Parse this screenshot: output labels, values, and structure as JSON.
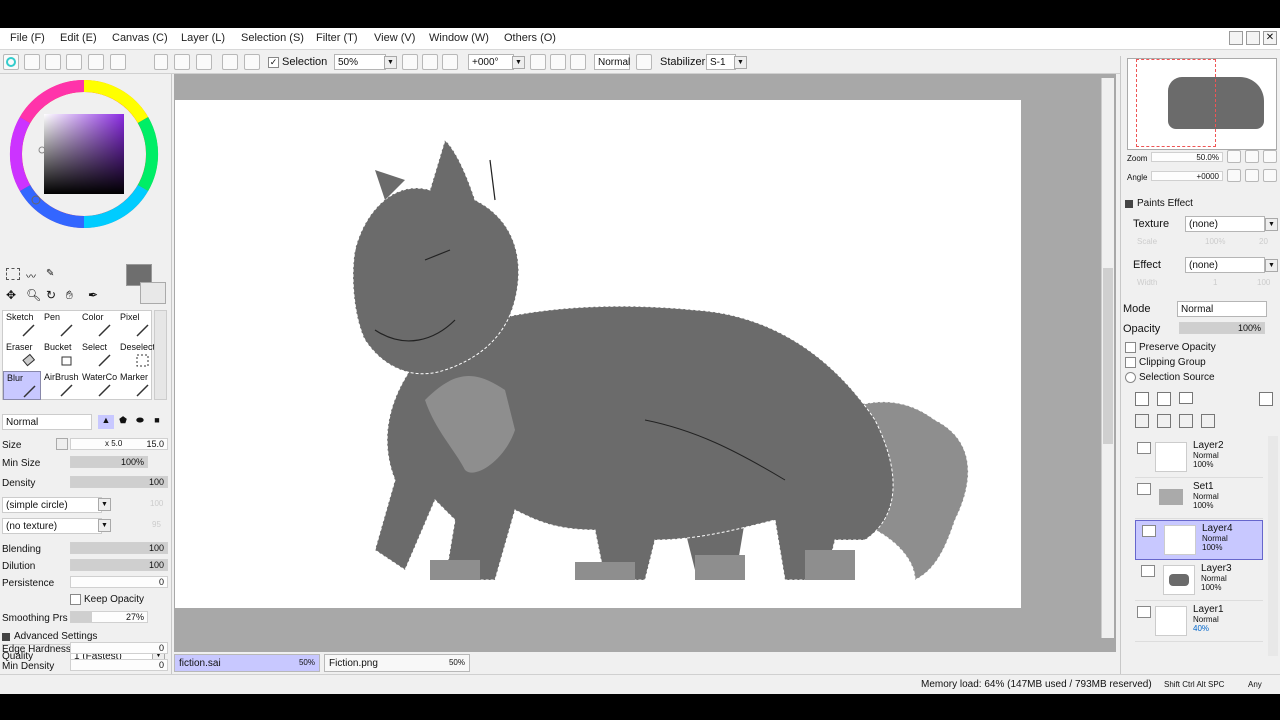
{
  "menubar": {
    "items": [
      "File (F)",
      "Edit (E)",
      "Canvas (C)",
      "Layer (L)",
      "Selection (S)",
      "Filter (T)",
      "View (V)",
      "Window (W)",
      "Others (O)"
    ]
  },
  "toolbar": {
    "selection_label": "Selection",
    "zoom_value": "50%",
    "angle_value": "+000°",
    "blend_mode": "Normal",
    "stabilizer_label": "Stabilizer",
    "stabilizer_value": "S-1"
  },
  "tools": {
    "grid": [
      {
        "name": "Sketch"
      },
      {
        "name": "Pen"
      },
      {
        "name": "Color"
      },
      {
        "name": "Pixel"
      },
      {
        "name": "Eraser"
      },
      {
        "name": "Bucket"
      },
      {
        "name": "Select"
      },
      {
        "name": "Deselect"
      },
      {
        "name": "Blur"
      },
      {
        "name": "AirBrush"
      },
      {
        "name": "WaterCo"
      },
      {
        "name": "Marker"
      }
    ]
  },
  "brush": {
    "mode": "Normal",
    "size_label": "Size",
    "size_mult": "x 5.0",
    "size_value": "15.0",
    "minsize_label": "Min Size",
    "minsize_value": "100%",
    "density_label": "Density",
    "density_value": "100",
    "shape": "(simple circle)",
    "shape_val": "100",
    "texture": "(no texture)",
    "texture_val": "95",
    "blending_label": "Blending",
    "blending_value": "100",
    "dilution_label": "Dilution",
    "dilution_value": "100",
    "persistence_label": "Persistence",
    "persistence_value": "0",
    "keep_opacity_label": "Keep Opacity",
    "smoothing_label": "Smoothing Prs",
    "smoothing_value": "27%",
    "advanced_label": "Advanced Settings",
    "quality_label": "Quality",
    "quality_value": "1 (Fastest)",
    "edge_label": "Edge Hardness",
    "edge_value": "0",
    "mindensity_label": "Min Density",
    "mindensity_value": "0"
  },
  "navigator": {
    "zoom_label": "Zoom",
    "zoom_value": "50.0%",
    "angle_label": "Angle",
    "angle_value": "+0000"
  },
  "paints_effect": {
    "header": "Paints Effect",
    "texture_label": "Texture",
    "texture_value": "(none)",
    "scale_label": "Scale",
    "scale_value": "100%",
    "scale_num": "20",
    "effect_label": "Effect",
    "effect_value": "(none)",
    "width_label": "Width",
    "width_value": "1",
    "width_num": "100"
  },
  "layer_props": {
    "mode_label": "Mode",
    "mode_value": "Normal",
    "opacity_label": "Opacity",
    "opacity_value": "100%",
    "preserve_label": "Preserve Opacity",
    "clipping_label": "Clipping Group",
    "selsource_label": "Selection Source"
  },
  "layers": [
    {
      "name": "Layer2",
      "mode": "Normal",
      "opacity": "100%",
      "selected": false
    },
    {
      "name": "Set1",
      "mode": "Normal",
      "opacity": "100%",
      "selected": false
    },
    {
      "name": "Layer4",
      "mode": "Normal",
      "opacity": "100%",
      "selected": true
    },
    {
      "name": "Layer3",
      "mode": "Normal",
      "opacity": "100%",
      "selected": false
    },
    {
      "name": "Layer1",
      "mode": "Normal",
      "opacity": "40%",
      "selected": false
    }
  ],
  "filetabs": [
    {
      "name": "fiction.sai",
      "zoom": "50%"
    },
    {
      "name": "Fiction.png",
      "zoom": "50%"
    }
  ],
  "status": {
    "memory": "Memory load: 64% (147MB used / 793MB reserved)",
    "keys": "Shift Ctrl Alt SPC",
    "any": "Any"
  },
  "colors": {
    "accent": "#c8c8ff",
    "fur_dark": "#6b6b6b",
    "fur_light": "#8e8e8e",
    "canvas_bg": "#a8a8a8"
  }
}
